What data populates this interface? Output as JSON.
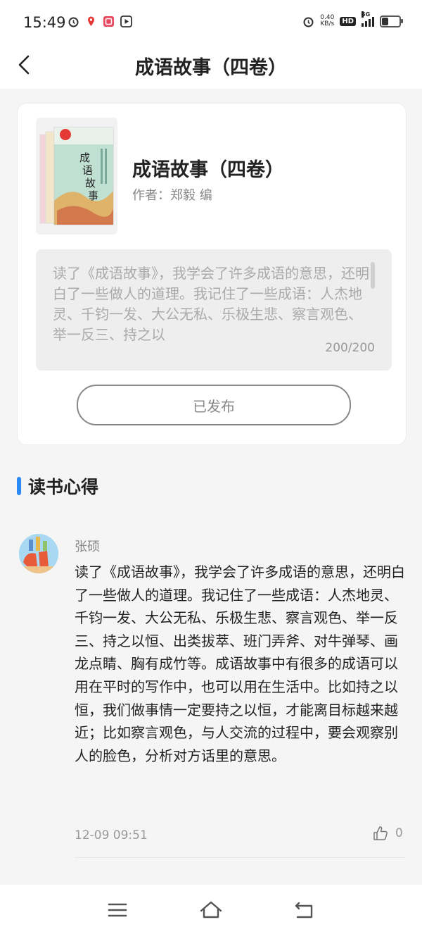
{
  "status_bar": {
    "time": "15:49",
    "net_speed_value": "0.40",
    "net_speed_unit": "KB/s",
    "hd_label": "HD",
    "signal_label": "5G"
  },
  "nav": {
    "title": "成语故事（四卷）"
  },
  "book": {
    "title": "成语故事（四卷）",
    "author": "作者：郑毅 编"
  },
  "review": {
    "text": "读了《成语故事》，我学会了许多成语的意思，还明白了一些做人的道理。我记住了一些成语：人杰地灵、千钧一发、大公无私、乐极生悲、察言观色、举一反三、持之以",
    "char_count": "200/200"
  },
  "publish_button": {
    "label": "已发布"
  },
  "section": {
    "title": "读书心得"
  },
  "comment": {
    "user": "张硕",
    "text": "读了《成语故事》，我学会了许多成语的意思，还明白了一些做人的道理。我记住了一些成语：人杰地灵、千钧一发、大公无私、乐极生悲、察言观色、举一反三、持之以恒、出类拔萃、班门弄斧、对牛弹琴、画龙点睛、胸有成竹等。成语故事中有很多的成语可以用在平时的写作中，也可以用在生活中。比如持之以恒，我们做事情一定要持之以恒，才能离目标越来越近；比如察言观色，与人交流的过程中，要会观察别人的脸色，分析对方话里的意思。",
    "time": "12-09 09:51",
    "like_count": "0"
  },
  "colors": {
    "accent": "#2b8af7",
    "background": "#f5f5f5",
    "muted_text": "#999999"
  },
  "icons": [
    "back-arrow-icon",
    "thumbs-up-icon",
    "menu-icon",
    "home-icon",
    "return-icon"
  ]
}
